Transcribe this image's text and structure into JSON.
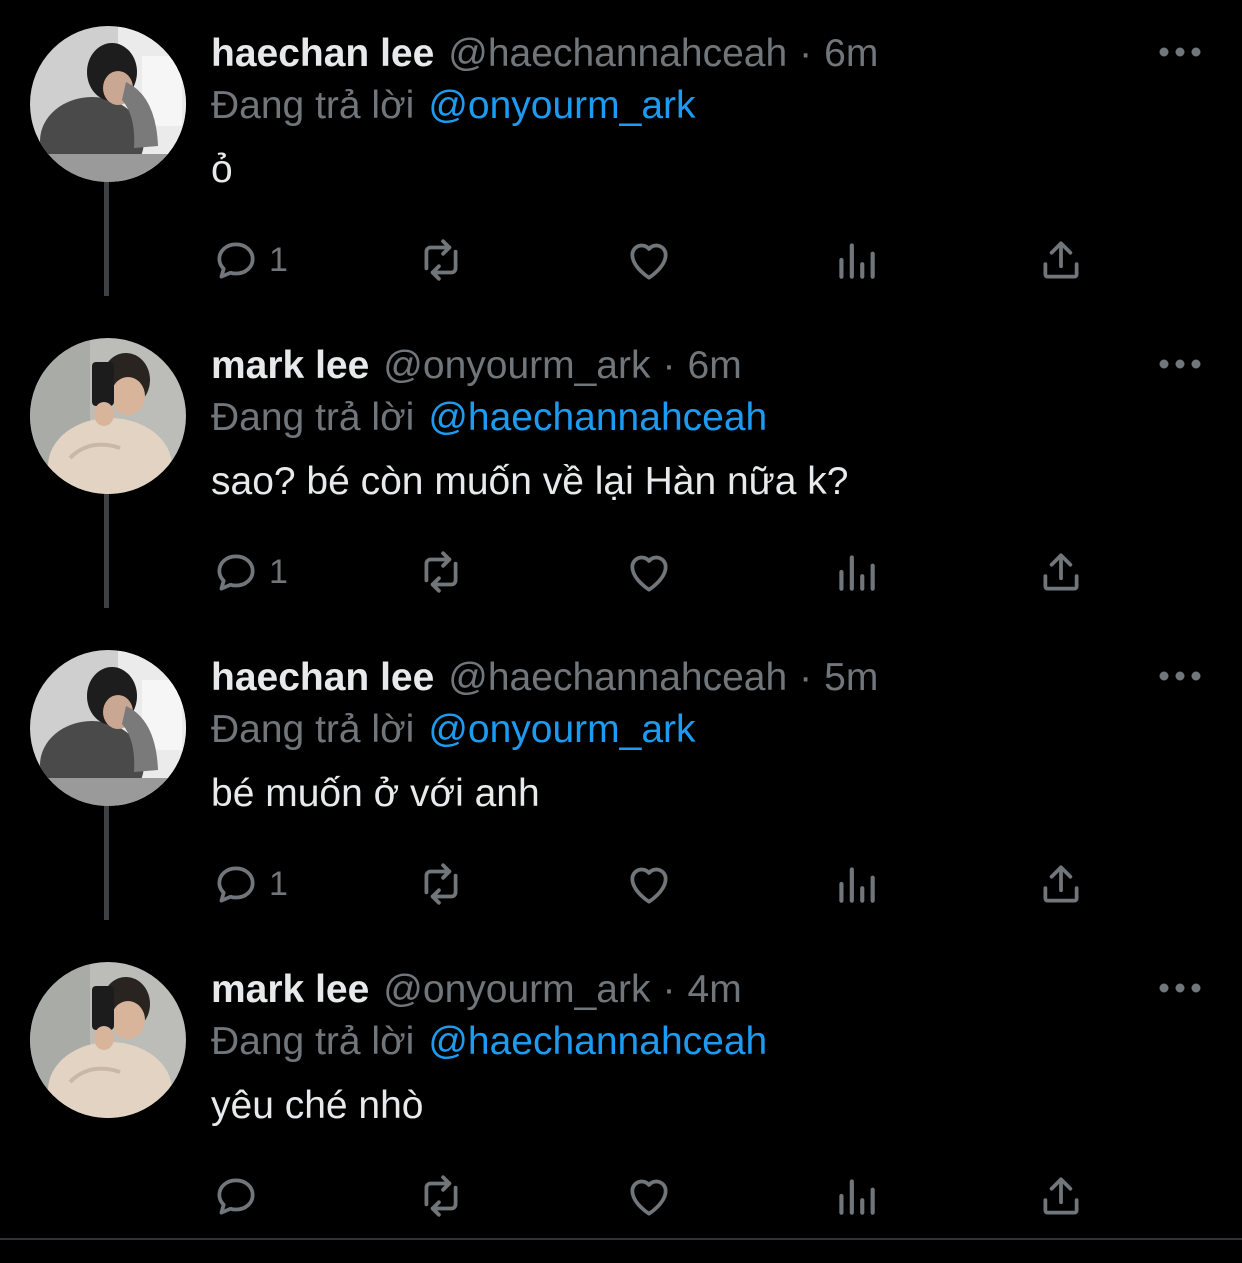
{
  "reply_prefix": "Đang trả lời",
  "colors": {
    "background": "#000000",
    "accent": "#1d9bf0",
    "muted": "#71767b",
    "text": "#e7e9ea"
  },
  "icons": {
    "reply": "reply-icon",
    "retweet": "retweet-icon",
    "like": "heart-icon",
    "views": "views-icon",
    "share": "share-icon",
    "more": "more-icon"
  },
  "tweets": [
    {
      "name": "haechan lee",
      "handle": "@haechannahceah",
      "time": "6m",
      "replying_to": "@onyourm_ark",
      "text": "ỏ",
      "reply_count": "1"
    },
    {
      "name": "mark lee",
      "handle": "@onyourm_ark",
      "time": "6m",
      "replying_to": "@haechannahceah",
      "text": "sao? bé còn muốn về lại Hàn nữa k?",
      "reply_count": "1"
    },
    {
      "name": "haechan lee",
      "handle": "@haechannahceah",
      "time": "5m",
      "replying_to": "@onyourm_ark",
      "text": "bé muốn ở với anh",
      "reply_count": "1"
    },
    {
      "name": "mark lee",
      "handle": "@onyourm_ark",
      "time": "4m",
      "replying_to": "@haechannahceah",
      "text": "yêu ché nhò",
      "reply_count": ""
    }
  ]
}
